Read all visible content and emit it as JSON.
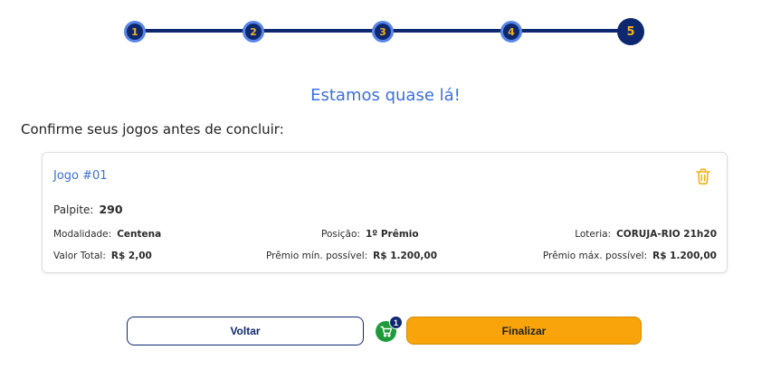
{
  "stepper": {
    "steps": [
      "1",
      "2",
      "3",
      "4",
      "5"
    ],
    "active": "5"
  },
  "headline": "Estamos quase lá!",
  "subtitle": "Confirme seus jogos antes de concluir:",
  "card": {
    "title": "Jogo #01",
    "guess_label": "Palpite:",
    "guess_value": "290",
    "modalidade_label": "Modalidade:",
    "modalidade_value": "Centena",
    "posicao_label": "Posição:",
    "posicao_value": "1º Prêmio",
    "loteria_label": "Loteria:",
    "loteria_value": "CORUJA-RIO 21h20",
    "valor_label": "Valor Total:",
    "valor_value": "R$ 2,00",
    "premio_min_label": "Prêmio mín. possível:",
    "premio_min_value": "R$ 1.200,00",
    "premio_max_label": "Prêmio máx. possível:",
    "premio_max_value": "R$ 1.200,00",
    "trash_icon": "trash-icon"
  },
  "actions": {
    "back_label": "Voltar",
    "finish_label": "Finalizar",
    "cart_count": "1"
  },
  "colors": {
    "primary": "#0e2870",
    "accent": "#3a6fe0",
    "highlight": "#f2b21c",
    "finish_button": "#f8a40a",
    "cart": "#1e9a3a"
  }
}
